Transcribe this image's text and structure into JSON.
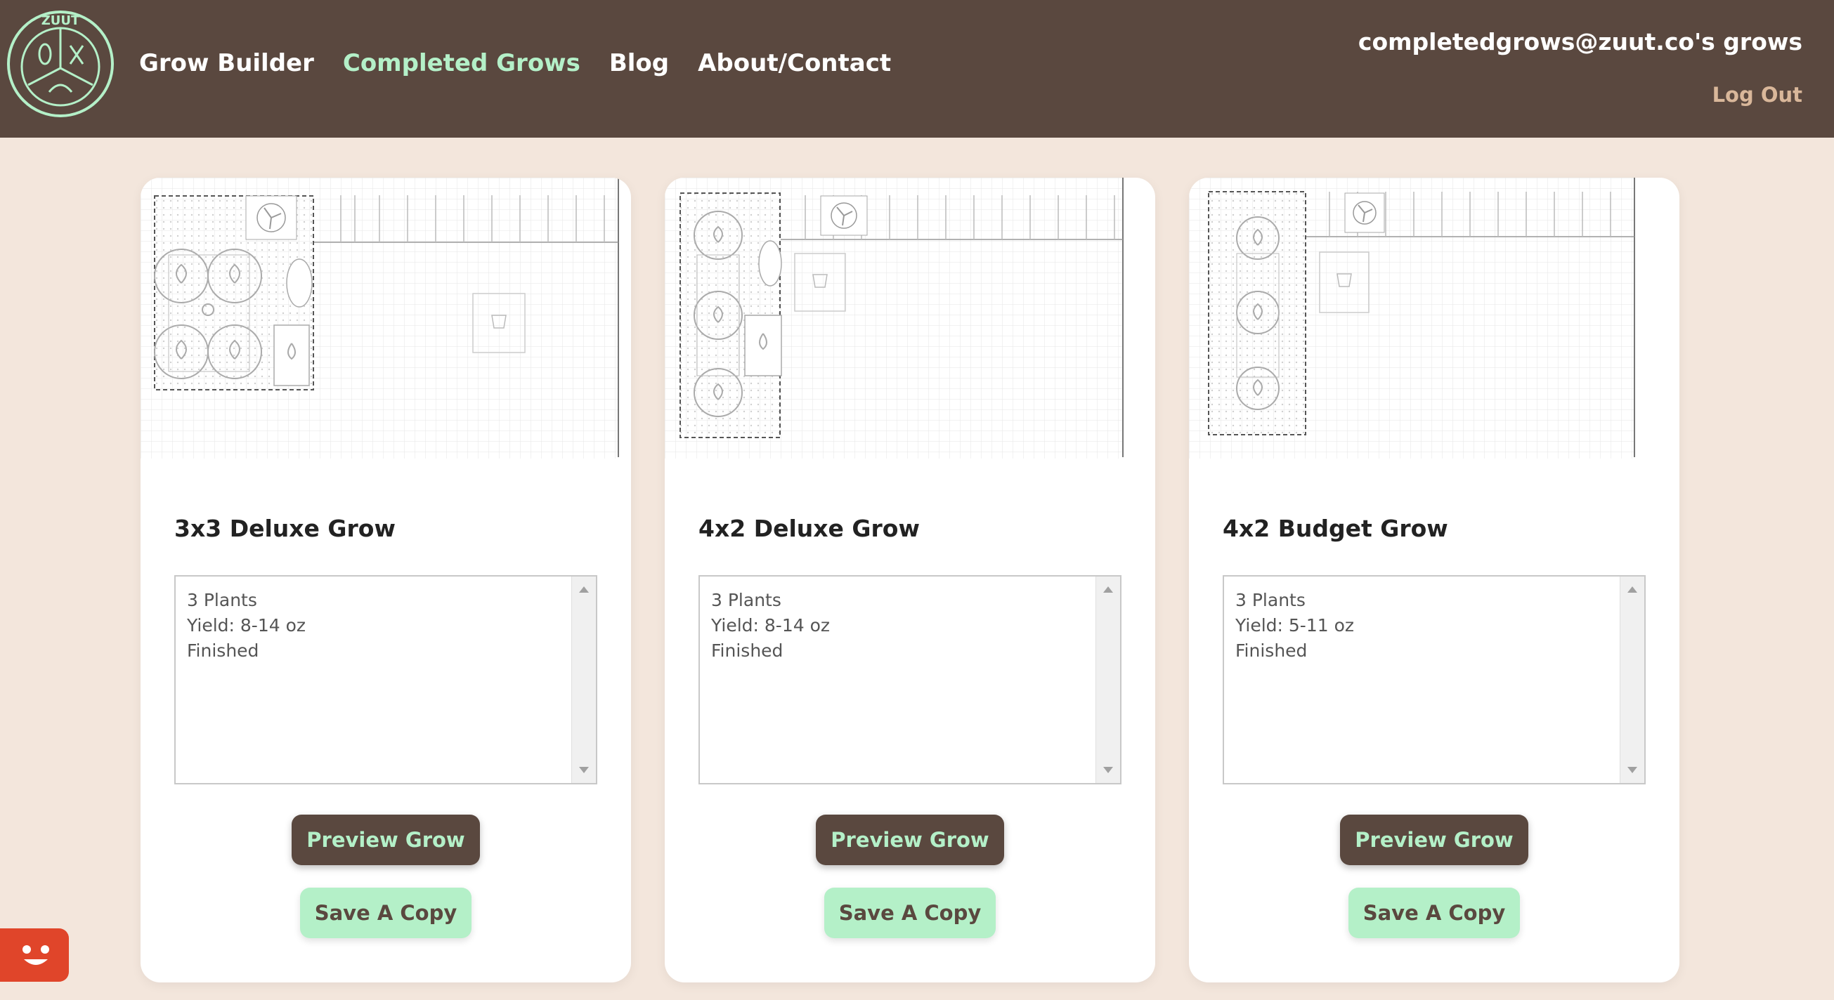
{
  "header": {
    "logo_text": "ZUUT",
    "nav": [
      {
        "label": "Grow Builder",
        "active": false
      },
      {
        "label": "Completed Grows",
        "active": true
      },
      {
        "label": "Blog",
        "active": false
      },
      {
        "label": "About/Contact",
        "active": false
      }
    ],
    "user_label": "completedgrows@zuut.co's grows",
    "logout_label": "Log Out"
  },
  "cards": [
    {
      "title": "3x3 Deluxe Grow",
      "details": [
        "3 Plants",
        "Yield: 8-14 oz",
        "Finished"
      ],
      "preview_label": "Preview Grow",
      "copy_label": "Save A Copy"
    },
    {
      "title": "4x2 Deluxe Grow",
      "details": [
        "3 Plants",
        "Yield: 8-14 oz",
        "Finished"
      ],
      "preview_label": "Preview Grow",
      "copy_label": "Save A Copy"
    },
    {
      "title": "4x2 Budget Grow",
      "details": [
        "3 Plants",
        "Yield: 5-11 oz",
        "Finished"
      ],
      "preview_label": "Preview Grow",
      "copy_label": "Save A Copy"
    }
  ],
  "colors": {
    "header_bg": "#5a483f",
    "accent_mint": "#b4f0c8",
    "page_bg": "#f3e6dc",
    "chat_widget": "#e0452a"
  },
  "icons": [
    "zuut-logo-icon",
    "fan-icon",
    "plant-icon",
    "water-drop-icon",
    "pot-icon",
    "chat-widget-icon"
  ]
}
